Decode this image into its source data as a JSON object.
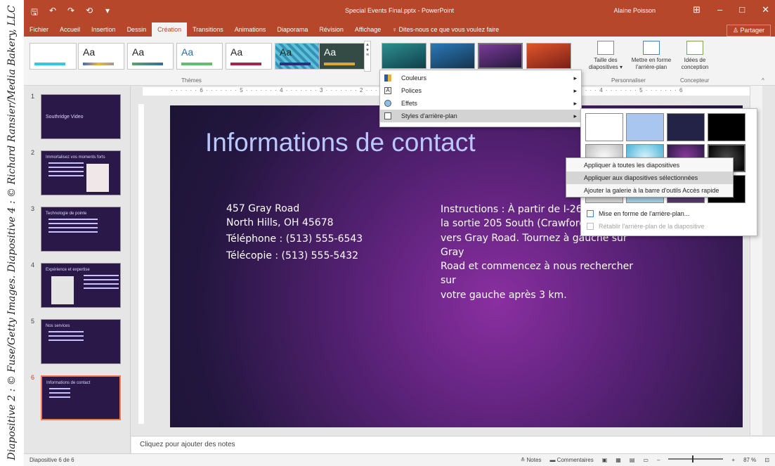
{
  "credit": "Diapositive 2 : © Fuse/Getty Images. Diapositive 4 : © Richard Ransier/Media Bakery, LLC",
  "titlebar": {
    "title": "Special Events Final.pptx - PowerPoint",
    "user": "Alaine Poisson",
    "controls": [
      "⊞",
      "–",
      "□",
      "✕"
    ]
  },
  "qat": [
    "🖫",
    "↶",
    "↷",
    "⟲",
    "▾"
  ],
  "ribbon_tabs": [
    "Fichier",
    "Accueil",
    "Insertion",
    "Dessin",
    "Création",
    "Transitions",
    "Animations",
    "Diaporama",
    "Révision",
    "Affichage"
  ],
  "active_tab": "Création",
  "tell_me": "Dites-nous ce que vous voulez faire",
  "share": "Partager",
  "themes": {
    "label": "Thèmes",
    "tiles": [
      {
        "text": "Aa",
        "bg": "#1f3d8f",
        "fg": "#ffffff"
      },
      {
        "text": "Aa",
        "bg": "#ffffff",
        "fg": "#333333"
      },
      {
        "text": "Aa",
        "bg": "#eef5ee",
        "fg": "#333333"
      },
      {
        "text": "Aa",
        "bg": "#d8ed88",
        "fg": "#2b6bb0"
      },
      {
        "text": "Aa",
        "bg": "#ffffff",
        "fg": "#333333"
      },
      {
        "text": "Aa",
        "bg": "#5bc3d7",
        "fg": "#000000"
      },
      {
        "text": "Aa",
        "bg": "#344b45",
        "fg": "#ffffff"
      }
    ]
  },
  "variants": [
    {
      "bg": "#1d6d73"
    },
    {
      "bg": "#1d5a92"
    },
    {
      "bg": "#4a1f63"
    },
    {
      "bg": "#a03d1f"
    }
  ],
  "customize": {
    "label": "Personnaliser",
    "slide_size": "Taille des diapositives ▾",
    "format_bg": "Mettre en forme l'arrière-plan"
  },
  "designer": {
    "label": "Concepteur",
    "button": "Idées de conception"
  },
  "variants_menu": {
    "items": [
      "Couleurs",
      "Polices",
      "Effets",
      "Styles d'arrière-plan"
    ],
    "hover_index": 3
  },
  "bg_styles": {
    "swatches": [
      {
        "bg": "#ffffff"
      },
      {
        "bg": "#a9c6f1"
      },
      {
        "bg": "#232347"
      },
      {
        "bg": "#000000"
      },
      {
        "bg": "#e7e7e7"
      },
      {
        "bg": "#7dc6d9"
      },
      {
        "bg": "#4a2a63"
      },
      {
        "bg": "#1d1d1d"
      },
      {
        "bg": "#cfcfcf"
      },
      {
        "bg": "#9fcde0"
      },
      {
        "bg": "#55386c"
      },
      {
        "bg": "#000000"
      }
    ],
    "format_link": "Mise en forme de l'arrière-plan...",
    "reset_link": "Rétablir l'arrière-plan de la diapositive"
  },
  "context_menu": {
    "items": [
      "Appliquer à toutes les diapositives",
      "Appliquer aux diapositives sélectionnées",
      "Ajouter la galerie à la barre d'outils Accès rapide"
    ],
    "hover_index": 1
  },
  "thumbnails": [
    {
      "num": "1",
      "title": "Southridge Video"
    },
    {
      "num": "2",
      "title": "Immortalisez vos moments forts"
    },
    {
      "num": "3",
      "title": "Technologie de pointe"
    },
    {
      "num": "4",
      "title": "Expérience et expertise"
    },
    {
      "num": "5",
      "title": "Nos services"
    },
    {
      "num": "6",
      "title": "Informations de contact"
    }
  ],
  "active_slide": 6,
  "slide": {
    "title": "Informations de contact",
    "address_line1": "457 Gray Road",
    "address_line2": "North Hills, OH 45678",
    "phone": "Téléphone : (513) 555-6543",
    "fax": "Télécopie : (513) 555-5432",
    "instructions": "Instructions : À partir de I-261 Ea\nla sortie 205 South (Crawfordsvi\nvers Gray Road. Tournez à gauche sur Gray\nRoad et commencez à nous rechercher sur\nvotre gauche après 3 km."
  },
  "ruler_labels": [
    "6",
    "5",
    "4",
    "3",
    "2",
    "1",
    "0",
    "1",
    "2",
    "3",
    "4",
    "5",
    "6"
  ],
  "notes_placeholder": "Cliquez pour ajouter des notes",
  "status": {
    "slide_info": "Diapositive 6 de 6",
    "notes": "Notes",
    "comments": "Commentaires",
    "zoom": "87 %"
  }
}
